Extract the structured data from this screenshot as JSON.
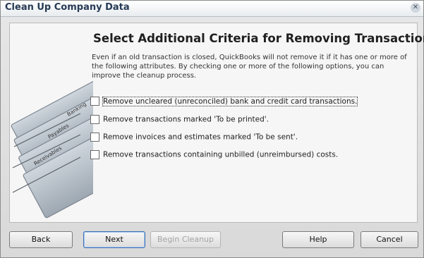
{
  "window": {
    "title": "Clean Up Company Data"
  },
  "content": {
    "heading": "Select Additional Criteria for Removing Transactions",
    "description": "Even if an old transaction is closed, QuickBooks will not remove it if it has one or more of the following attributes.  By checking one or more of the following options, you can improve the cleanup process.",
    "art_tabs": [
      "Banking",
      "Payables",
      "Receivables"
    ],
    "options": [
      {
        "label": "Remove uncleared (unreconciled) bank and credit card transactions.",
        "checked": false
      },
      {
        "label": "Remove transactions marked 'To be printed'.",
        "checked": false
      },
      {
        "label": "Remove invoices and estimates marked 'To be sent'.",
        "checked": false
      },
      {
        "label": "Remove transactions containing unbilled (unreimbursed) costs.",
        "checked": false
      }
    ]
  },
  "buttons": {
    "back": "Back",
    "next": "Next",
    "begin_cleanup": "Begin Cleanup",
    "help": "Help",
    "cancel": "Cancel"
  },
  "colors": {
    "title_text": "#263a55",
    "panel_bg": "#f6f6f6",
    "window_bg": "#dcdcdc"
  }
}
